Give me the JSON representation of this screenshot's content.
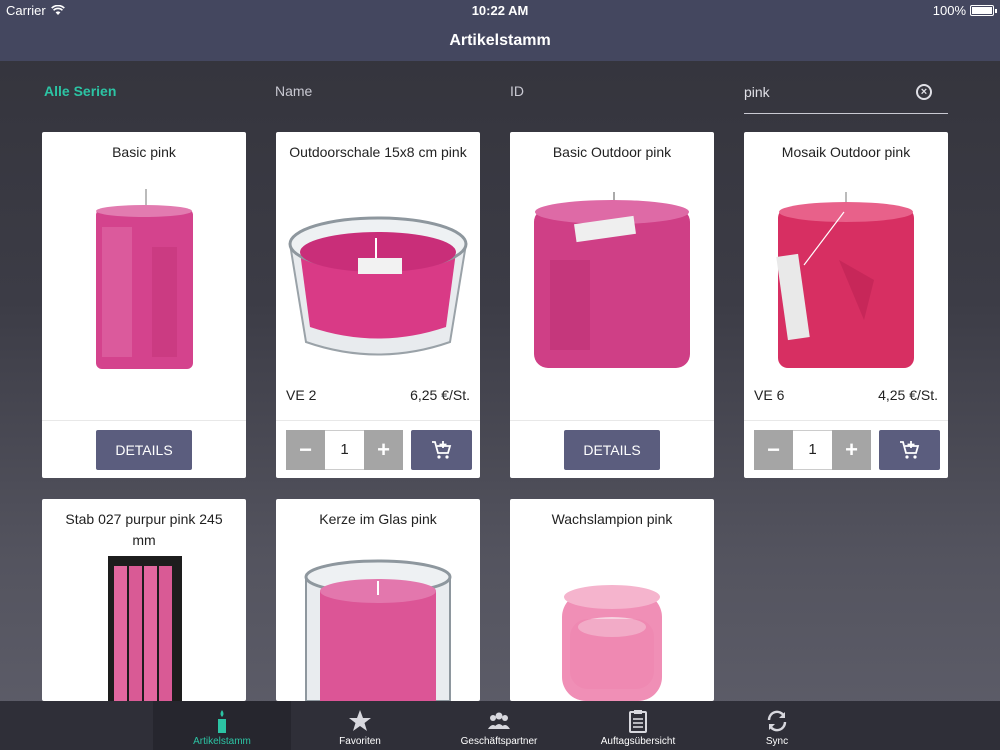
{
  "status_bar": {
    "carrier": "Carrier",
    "time": "10:22 AM",
    "battery": "100%"
  },
  "nav": {
    "title": "Artikelstamm"
  },
  "filters": {
    "series": "Alle Serien",
    "name": "Name",
    "id": "ID",
    "search_value": "pink"
  },
  "products": [
    {
      "title": "Basic pink",
      "button": "DETAILS"
    },
    {
      "title": "Outdoorschale 15x8 cm pink",
      "ve": "VE 2",
      "price": "6,25 €/St.",
      "qty": "1",
      "minus": "−",
      "plus": "+"
    },
    {
      "title": "Basic Outdoor pink",
      "button": "DETAILS"
    },
    {
      "title": "Mosaik Outdoor pink",
      "ve": "VE 6",
      "price": "4,25 €/St.",
      "qty": "1",
      "minus": "−",
      "plus": "+"
    },
    {
      "title": "Stab 027 purpur pink 245 mm"
    },
    {
      "title": "Kerze im Glas pink"
    },
    {
      "title": "Wachslampion pink"
    }
  ],
  "tabs": [
    {
      "label": "Artikelstamm",
      "icon": "candle-icon"
    },
    {
      "label": "Favoriten",
      "icon": "star-icon"
    },
    {
      "label": "Geschäftspartner",
      "icon": "people-icon"
    },
    {
      "label": "Auftagsübersicht",
      "icon": "clipboard-icon"
    },
    {
      "label": "Sync",
      "icon": "sync-icon"
    }
  ],
  "colors": {
    "accent": "#2cc4a4",
    "bar": "#44475f",
    "button": "#5b5d7e",
    "candle_pink": "#d63c8a"
  }
}
